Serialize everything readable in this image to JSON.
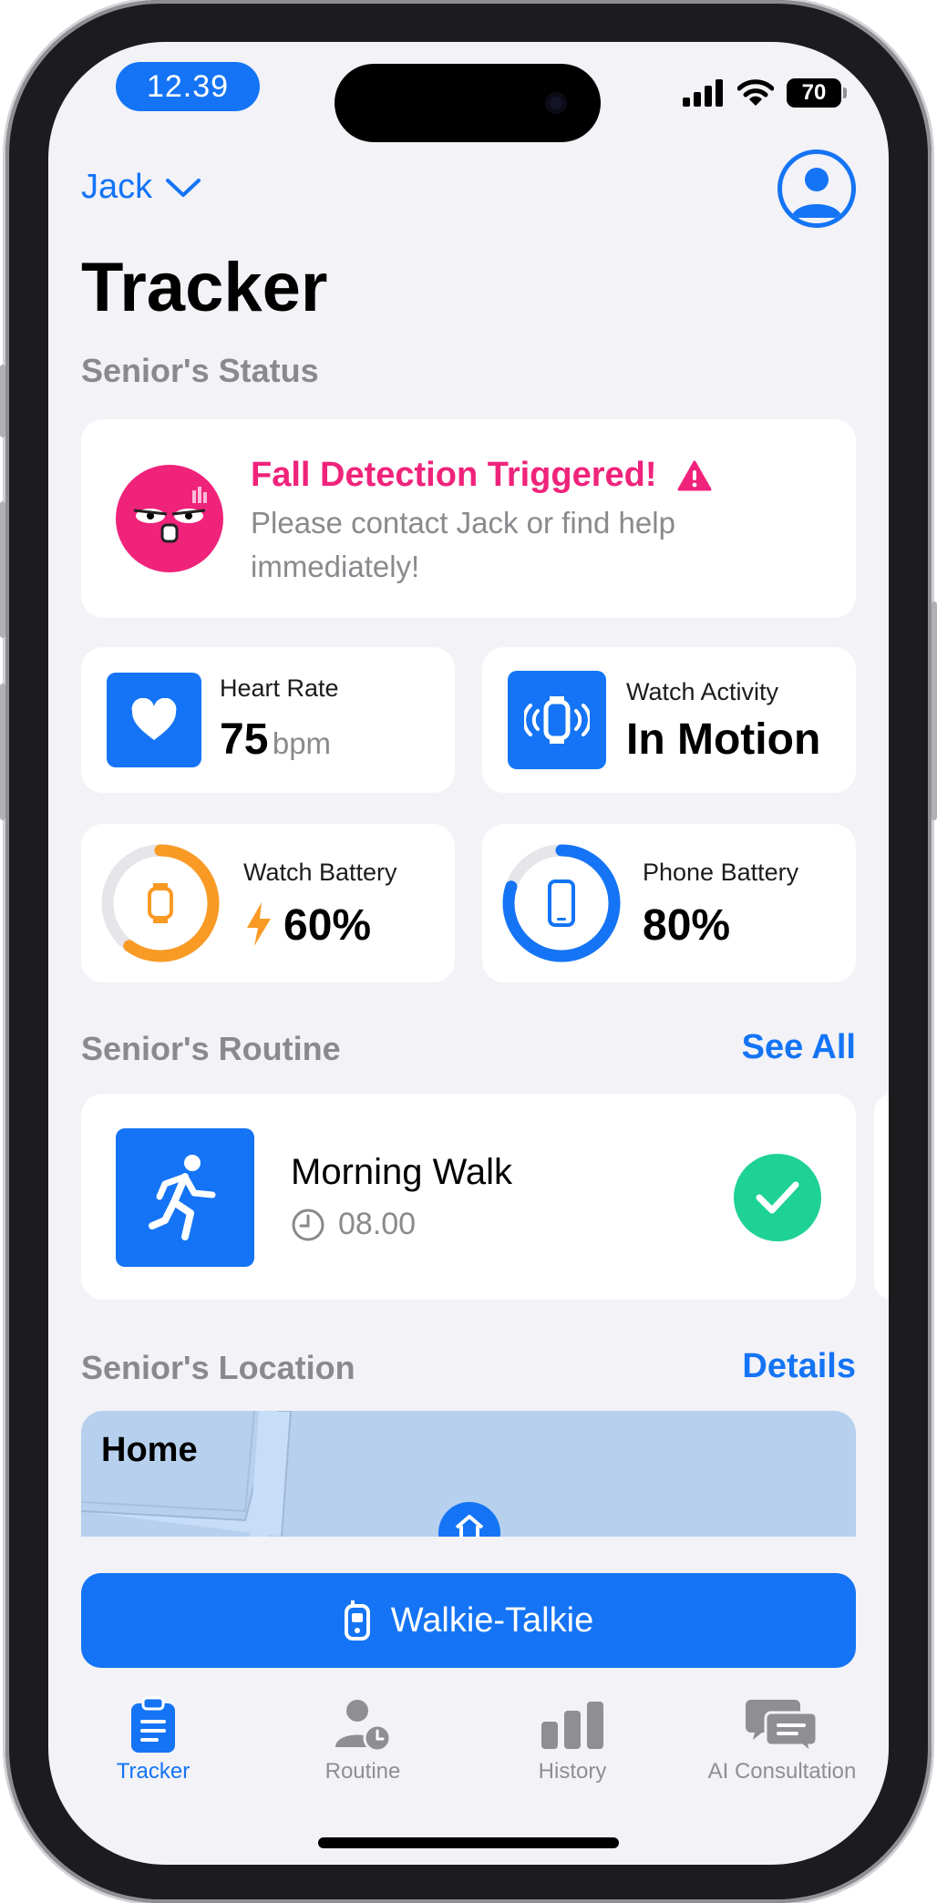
{
  "status_bar": {
    "time": "12.39",
    "battery": "70"
  },
  "header": {
    "user_name": "Jack"
  },
  "page_title": "Tracker",
  "status_section": {
    "heading": "Senior's Status",
    "alert": {
      "title": "Fall Detection Triggered!",
      "message": "Please contact Jack or find help immediately!",
      "color": "#f0237b"
    },
    "heart_rate": {
      "label": "Heart Rate",
      "value": "75",
      "unit": "bpm"
    },
    "watch_activity": {
      "label": "Watch Activity",
      "value": "In Motion"
    },
    "watch_battery": {
      "label": "Watch Battery",
      "value": "60%",
      "level": 0.6,
      "color": "#f99a25",
      "charging": true
    },
    "phone_battery": {
      "label": "Phone Battery",
      "value": "80%",
      "level": 0.8,
      "color": "#1474f5"
    }
  },
  "routine_section": {
    "heading": "Senior's Routine",
    "see_all": "See All",
    "items": [
      {
        "name": "Morning Walk",
        "time": "08.00",
        "done": true
      }
    ]
  },
  "location_section": {
    "heading": "Senior's Location",
    "details": "Details",
    "place": "Home"
  },
  "walkie_talkie": {
    "label": "Walkie-Talkie"
  },
  "tabs": [
    {
      "label": "Tracker",
      "icon": "clipboard-icon",
      "active": true
    },
    {
      "label": "Routine",
      "icon": "person-clock-icon",
      "active": false
    },
    {
      "label": "History",
      "icon": "bar-chart-icon",
      "active": false
    },
    {
      "label": "AI Consultation",
      "icon": "chat-bubbles-icon",
      "active": false
    }
  ],
  "colors": {
    "accent": "#1474f5",
    "success": "#1ed195",
    "background": "#f2f2f7"
  }
}
